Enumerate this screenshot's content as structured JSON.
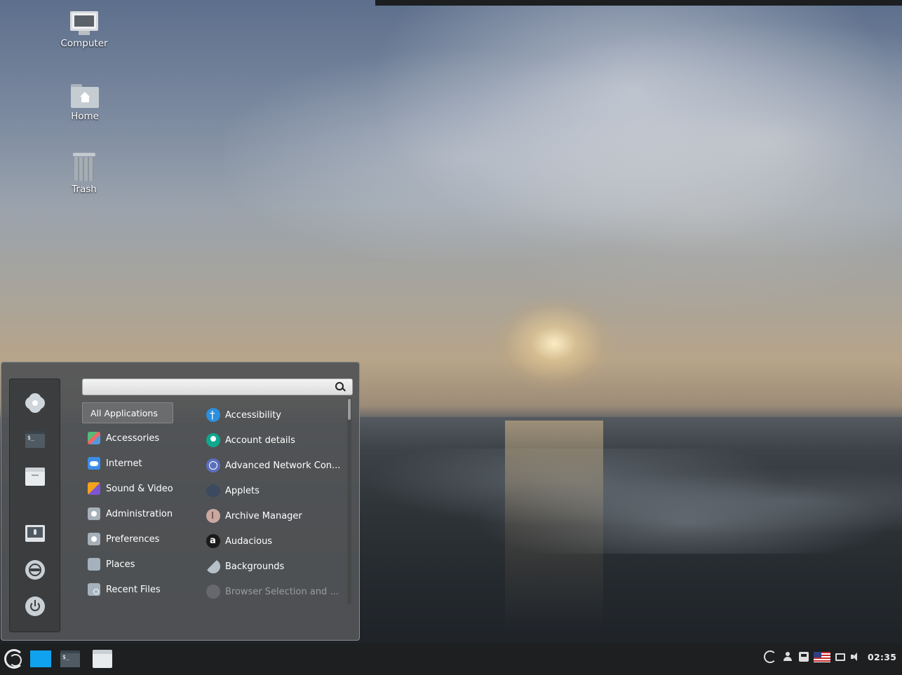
{
  "desktop": {
    "icons": [
      {
        "label": "Computer",
        "icon": "computer-icon"
      },
      {
        "label": "Home",
        "icon": "home-folder-icon"
      },
      {
        "label": "Trash",
        "icon": "trash-icon"
      }
    ]
  },
  "menu": {
    "search": {
      "value": "",
      "placeholder": ""
    },
    "favorites": [
      "settings-icon",
      "terminal-icon",
      "files-icon",
      "lock-screen-icon",
      "logout-icon",
      "power-icon"
    ],
    "categories": [
      {
        "label": "All Applications",
        "selected": true
      },
      {
        "label": "Accessories"
      },
      {
        "label": "Internet"
      },
      {
        "label": "Sound & Video"
      },
      {
        "label": "Administration"
      },
      {
        "label": "Preferences"
      },
      {
        "label": "Places"
      },
      {
        "label": "Recent Files"
      }
    ],
    "apps": [
      {
        "label": "Accessibility"
      },
      {
        "label": "Account details"
      },
      {
        "label": "Advanced Network Con..."
      },
      {
        "label": "Applets"
      },
      {
        "label": "Archive Manager"
      },
      {
        "label": "Audacious"
      },
      {
        "label": "Backgrounds"
      },
      {
        "label": "Browser Selection and ..."
      }
    ],
    "terminal_glyph": "$_"
  },
  "taskbar": {
    "clock": "02:35",
    "terminal_glyph": "$_"
  },
  "colors": {
    "taskbar_bg": "#1d1f21",
    "menu_bg": "#525456",
    "accent_blue": "#10a2ee"
  }
}
